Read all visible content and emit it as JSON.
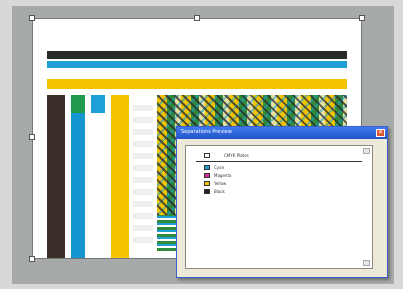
{
  "sheet": {
    "title": "",
    "bands": [
      {
        "name": "black-band",
        "color": "#2a2a2a"
      },
      {
        "name": "cyan-band",
        "color": "#1ea0d6"
      },
      {
        "name": "yellow-band",
        "color": "#f5c400"
      }
    ],
    "ink_columns": [
      {
        "name": "black-column",
        "color": "#3c2f2a"
      },
      {
        "name": "cyan-column",
        "color": "#1596d0"
      },
      {
        "name": "white-column",
        "color": "#ffffff"
      },
      {
        "name": "yellow-column",
        "color": "#f5c400"
      }
    ]
  },
  "dialog": {
    "title": "Separations Preview",
    "close_glyph": "✕",
    "separations": [
      {
        "label": "CMYK Plates",
        "color": "#ffffff"
      },
      {
        "label": "Cyan",
        "color": "#1ea0d6"
      },
      {
        "label": "Magenta",
        "color": "#d02f8f"
      },
      {
        "label": "Yellow",
        "color": "#f5c400"
      },
      {
        "label": "Black",
        "color": "#222222"
      }
    ]
  }
}
